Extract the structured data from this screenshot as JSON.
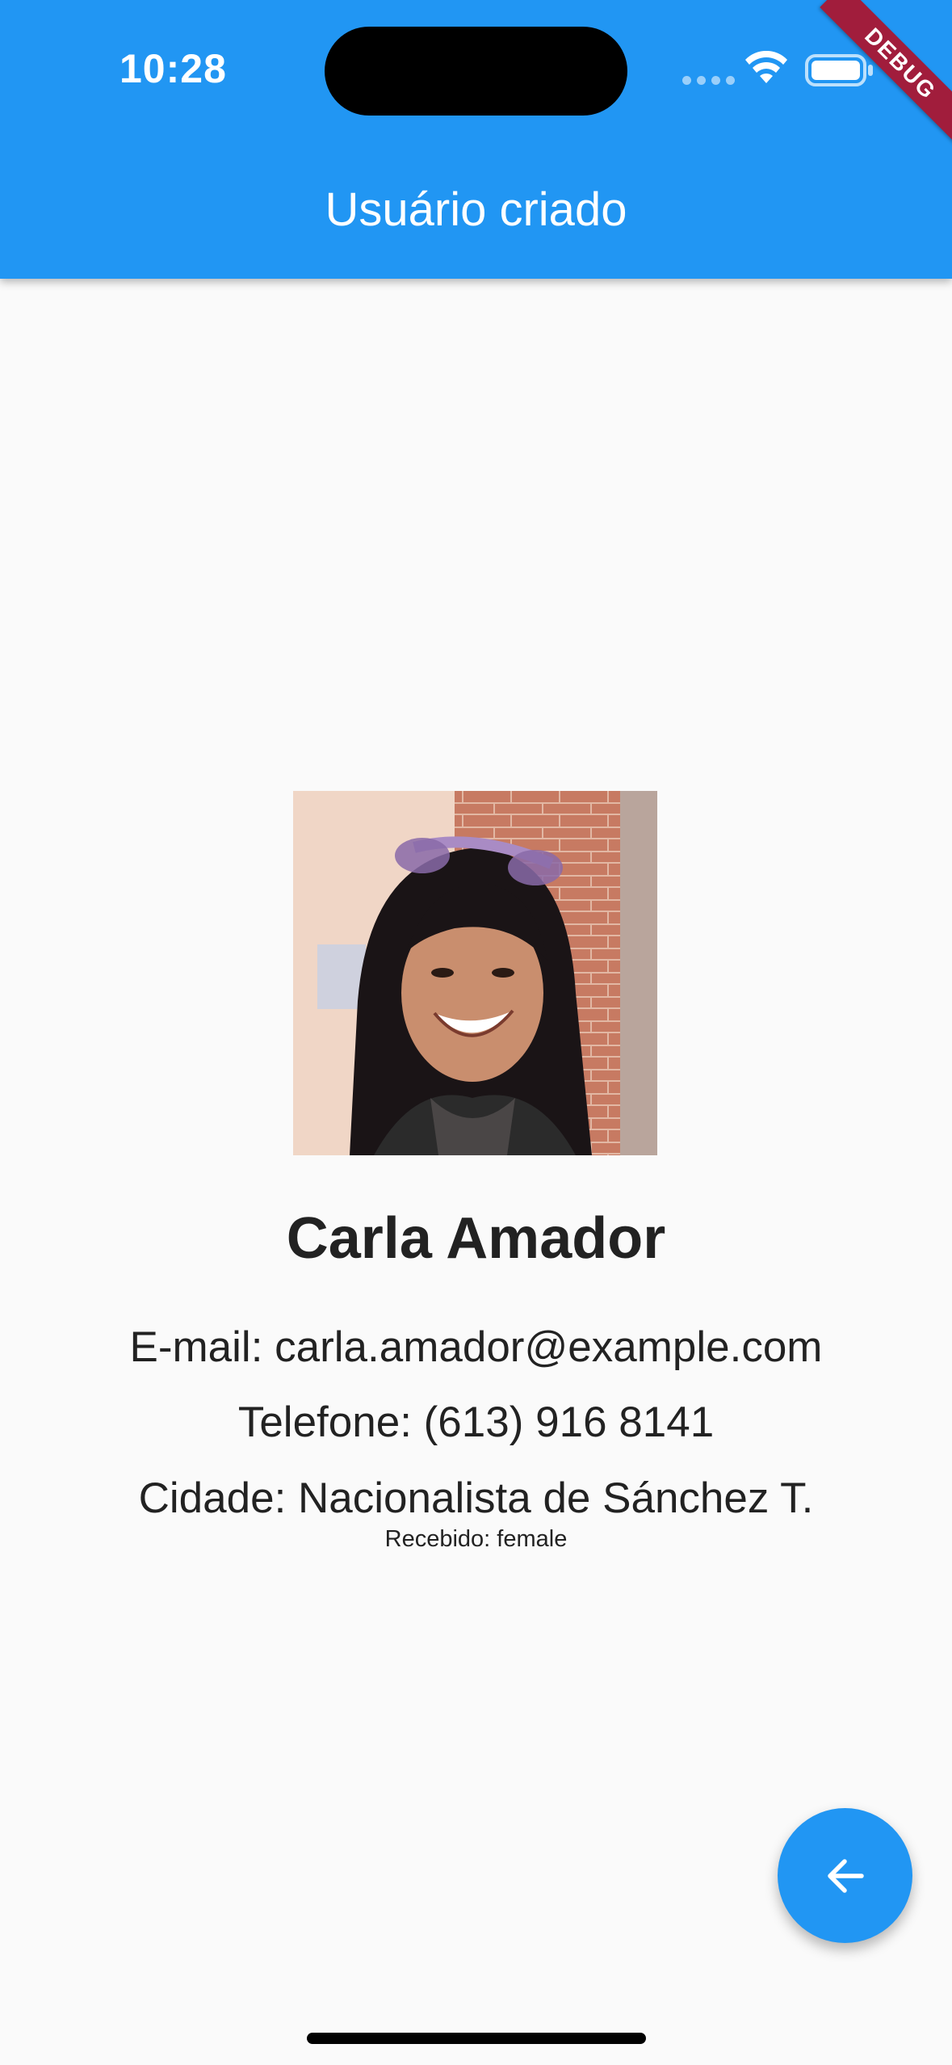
{
  "status_bar": {
    "time": "10:28"
  },
  "debug_banner": "DEBUG",
  "app_bar": {
    "title": "Usuário criado"
  },
  "user": {
    "name": "Carla Amador",
    "email_line": "E-mail: carla.amador@example.com",
    "phone_line": "Telefone: (613) 916 8141",
    "city_line": "Cidade: Nacionalista de Sánchez T.",
    "received_line": "Recebido: female"
  },
  "fab": {
    "icon": "arrow-back-icon"
  },
  "colors": {
    "primary": "#2196f3",
    "background": "#fafafa",
    "text": "#222222",
    "debug": "#a11d3c"
  }
}
